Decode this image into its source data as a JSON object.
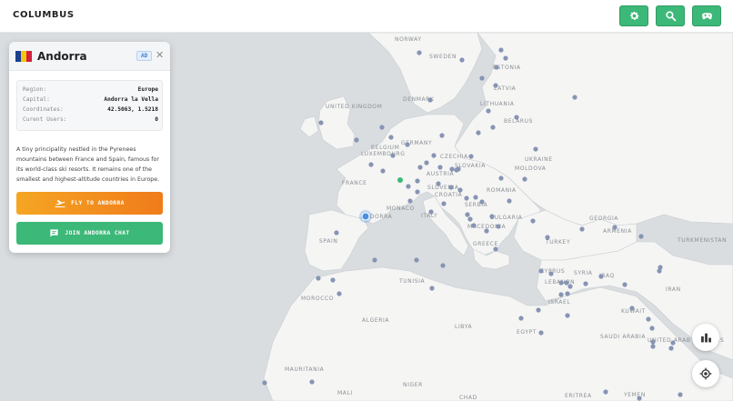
{
  "app": {
    "title": "COLUMBUS"
  },
  "toolbar": {
    "settings": "gear-icon",
    "search": "search-icon",
    "game": "gamepad-icon",
    "accent": "#3cb878"
  },
  "panel": {
    "country": "Andorra",
    "code": "AD",
    "flag_colors": [
      "#1d3f8f",
      "#f4c60f",
      "#d4213d"
    ],
    "rows": [
      {
        "key": "Region:",
        "value": "Europe"
      },
      {
        "key": "Capital:",
        "value": "Andorra la Vella"
      },
      {
        "key": "Coordinates:",
        "value": "42.5063, 1.5218"
      },
      {
        "key": "Curent Users:",
        "value": "0"
      }
    ],
    "description": "A tiny principality nestled in the Pyrenees mountains between France and Spain, famous for its world-class ski resorts. It remains one of the smallest and highest-altitude countries in Europe.",
    "fly_label": "FLY TO ANDORRA",
    "chat_label": "JOIN ANDORRA CHAT"
  },
  "map": {
    "labels": {
      "norway": "NORWAY",
      "sweden": "SWEDEN",
      "estonia": "ESTONIA",
      "latvia": "LATVIA",
      "lithuania": "LITHUANIA",
      "belarus": "BELARUS",
      "denmark": "DENMARK",
      "uk": "UNITED KINGDOM",
      "belgium": "BELGIUM",
      "germany": "GERMANY",
      "luxembourg": "LUXEMBOURG",
      "czechia": "CZECHIA",
      "slovakia": "SLOVAKIA",
      "austria": "AUSTRIA",
      "moldova": "MOLDOVA",
      "ukraine": "UKRAINE",
      "france": "FRANCE",
      "slovenia": "SLOVENIA",
      "croatia": "CROATIA",
      "romania": "ROMANIA",
      "serbia": "SERBIA",
      "bulgaria": "BULGARIA",
      "monaco": "MONACO",
      "italy": "ITALY",
      "andorra": "ANDORRA",
      "macedonia": "MACEDONIA",
      "georgia": "GEORGIA",
      "armenia": "ARMENIA",
      "spain": "SPAIN",
      "greece": "GREECE",
      "turkey": "TURKEY",
      "turkmenistan": "TURKMENISTAN",
      "cyprus": "CYPRUS",
      "syria": "SYRIA",
      "tunisia": "TUNISIA",
      "lebanon": "LEBANON",
      "israel": "ISRAEL",
      "iraq": "IRAQ",
      "iran": "IRAN",
      "morocco": "MOROCCO",
      "kuwait": "KUWAIT",
      "algeria": "ALGERIA",
      "libya": "LIBYA",
      "egypt": "EGYPT",
      "saudi": "SAUDI ARABIA",
      "uae": "UNITED ARAB EMIRATES",
      "mauritania": "MAURITANIA",
      "mali": "MALI",
      "niger": "NIGER",
      "chad": "CHAD",
      "eritrea": "ERITREA",
      "yemen": "YEMEN"
    },
    "land_color": "#f5f5f4",
    "water_color": "#d9dde0",
    "dot_color": "#8794b3",
    "active_dot_color": "#3cb878",
    "selected_color": "#4a90e2"
  },
  "fabs": {
    "stats": "bar-chart-icon",
    "locate": "crosshair-icon"
  }
}
